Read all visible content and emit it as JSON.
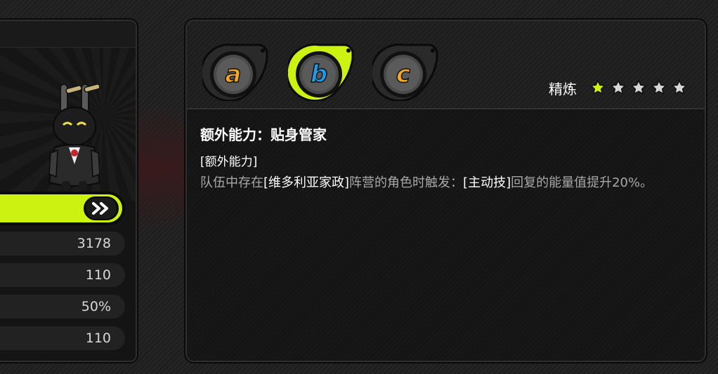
{
  "left_panel": {
    "stats": [
      "3178",
      "110",
      "50%",
      "110"
    ],
    "level_button_icon": "double-chevron-right-icon"
  },
  "discs": {
    "items": [
      {
        "letter": "a",
        "color": "#f5a623",
        "selected": false
      },
      {
        "letter": "b",
        "color": "#1e9be8",
        "selected": true
      },
      {
        "letter": "c",
        "color": "#f5a623",
        "selected": false
      }
    ],
    "accent": "#ccf211"
  },
  "refine": {
    "label": "精炼",
    "level": 1,
    "max": 5,
    "active_color": "#ccf211",
    "inactive_color": "#d6d6d6"
  },
  "ability": {
    "title": "额外能力：贴身管家",
    "tag": "[额外能力]",
    "desc_parts": [
      {
        "text": "队伍中存在",
        "hl": false
      },
      {
        "text": "[维多利亚家政]",
        "hl": true
      },
      {
        "text": "阵营的角色时触发：",
        "hl": false
      },
      {
        "text": "[主动技]",
        "hl": true
      },
      {
        "text": "回复的能量值提升20%。",
        "hl": false
      }
    ]
  }
}
